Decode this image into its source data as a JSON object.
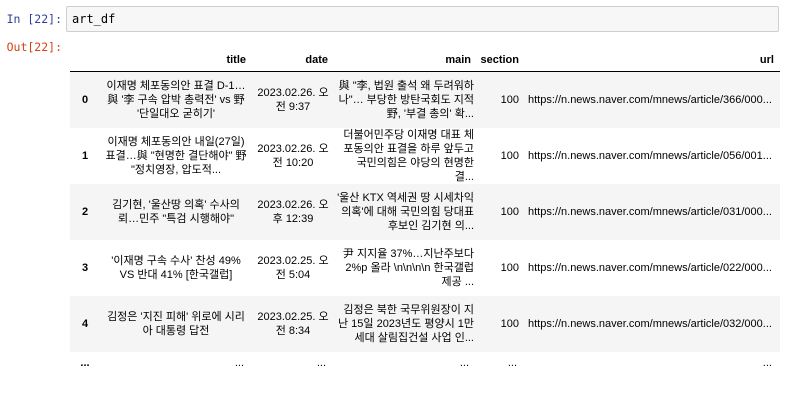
{
  "cell": {
    "in_prompt": "In [22]:",
    "out_prompt": "Out[22]:",
    "code": "art_df"
  },
  "table": {
    "columns": [
      "",
      "title",
      "date",
      "main",
      "section",
      "url"
    ],
    "rows": [
      {
        "index": "0",
        "title": "이재명 체포동의안 표결 D-1…與 '李 구속 압박 총력전' vs 野 '단일대오 굳히기'",
        "date": "2023.02.26. 오전 9:37",
        "main": "與 \"李, 법원 출석 왜 두려워하나\"… 부당한 방탄국회도 지적野, '부결 총의' 확...",
        "section": "100",
        "url": "https://n.news.naver.com/mnews/article/366/000..."
      },
      {
        "index": "1",
        "title": "이재명 체포동의안 내일(27일) 표결…與 \"현명한 결단해야\" 野 \"정치영장, 압도적...",
        "date": "2023.02.26. 오전 10:20",
        "main": "더불어민주당 이재명 대표 체포동의안 표결을 하루 앞두고 국민의힘은 야당의 현명한 결...",
        "section": "100",
        "url": "https://n.news.naver.com/mnews/article/056/001..."
      },
      {
        "index": "2",
        "title": "김기현, '울산땅 의혹' 수사의뢰…민주 \"특검 시행해야\"",
        "date": "2023.02.26. 오후 12:39",
        "main": "'울산 KTX 역세권 땅 시세차익 의혹'에 대해 국민의힘 당대표 후보인 김기현 의...",
        "section": "100",
        "url": "https://n.news.naver.com/mnews/article/031/000..."
      },
      {
        "index": "3",
        "title": "'이재명 구속 수사' 찬성 49% VS 반대 41% [한국갤럽]",
        "date": "2023.02.25. 오전 5:04",
        "main": "尹 지지율 37%…지난주보다 2%p 올라 \\n\\n\\n\\n 한국갤럽 제공  ...",
        "section": "100",
        "url": "https://n.news.naver.com/mnews/article/022/000..."
      },
      {
        "index": "4",
        "title": "김정은 '지진 피해' 위로에 시리아 대통령 답전",
        "date": "2023.02.25. 오전 8:34",
        "main": "김정은 북한 국무위원장이 지난 15일 2023년도 평양시 1만세대 살림집건설 사업 인...",
        "section": "100",
        "url": "https://n.news.naver.com/mnews/article/032/000..."
      }
    ],
    "ellipsis": "..."
  }
}
